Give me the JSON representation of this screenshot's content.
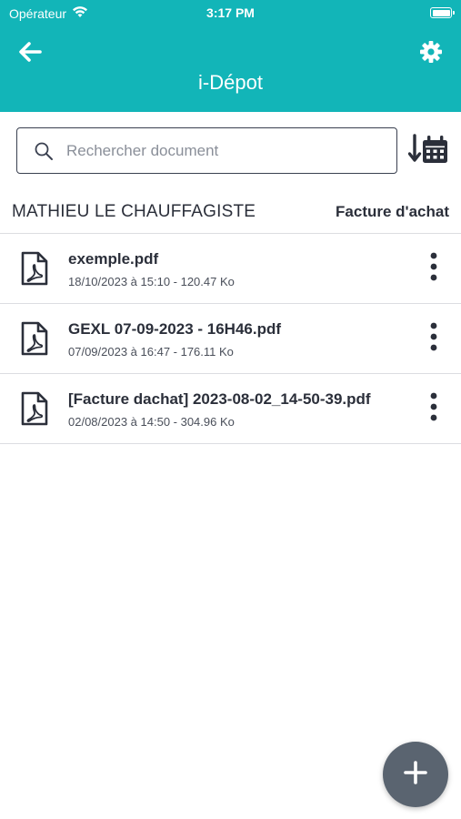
{
  "status_bar": {
    "carrier": "Opérateur",
    "time": "3:17 PM"
  },
  "header": {
    "title": "i-Dépot",
    "back_icon": "arrow-left-icon",
    "settings_icon": "gear-icon",
    "background_color": "#12b5b8"
  },
  "search": {
    "placeholder": "Rechercher document",
    "value": "",
    "sort_icon": "sort-by-date-icon"
  },
  "section": {
    "company": "MATHIEU LE CHAUFFAGISTE",
    "category": "Facture d'achat"
  },
  "documents": [
    {
      "name": "exemple.pdf",
      "meta": "18/10/2023 à 15:10 - 120.47 Ko",
      "icon": "pdf-file-icon"
    },
    {
      "name": "GEXL 07-09-2023 - 16H46.pdf",
      "meta": "07/09/2023 à 16:47 - 176.11 Ko",
      "icon": "pdf-file-icon"
    },
    {
      "name": "[Facture dachat] 2023-08-02_14-50-39.pdf",
      "meta": "02/08/2023 à 14:50 - 304.96 Ko",
      "icon": "pdf-file-icon"
    }
  ],
  "fab": {
    "icon": "plus-icon",
    "color": "#5a6470"
  }
}
